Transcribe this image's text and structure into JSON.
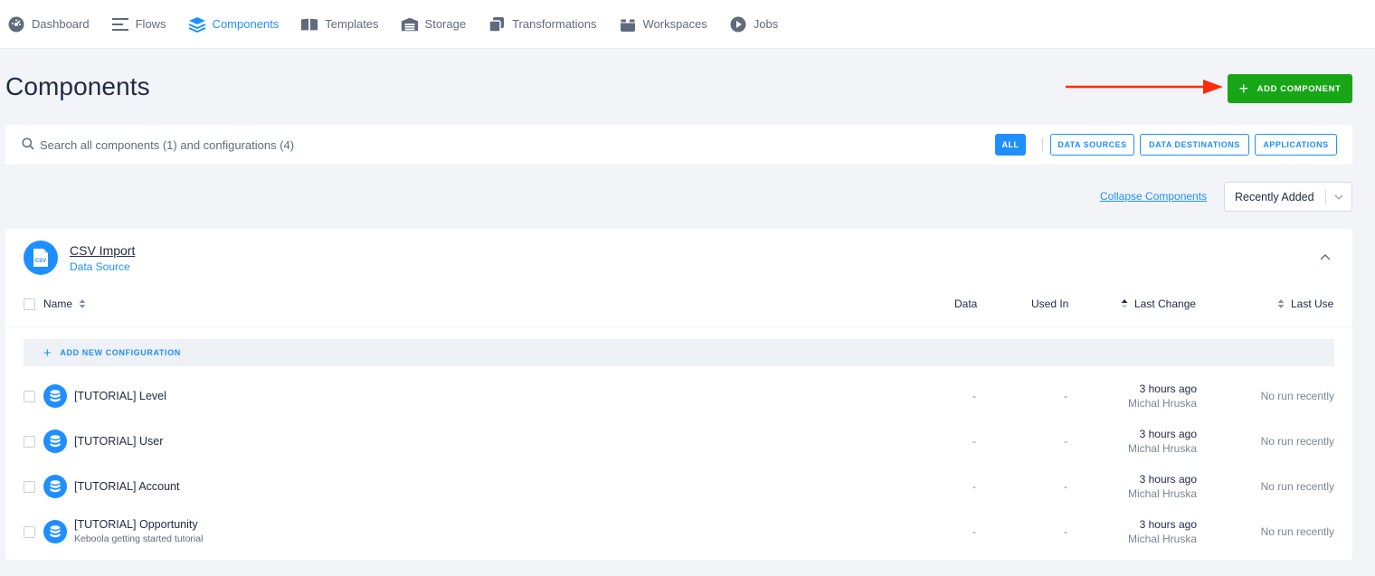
{
  "nav": {
    "items": [
      {
        "label": "Dashboard",
        "icon": "dashboard-icon",
        "active": false
      },
      {
        "label": "Flows",
        "icon": "flows-icon",
        "active": false
      },
      {
        "label": "Components",
        "icon": "layers-icon",
        "active": true
      },
      {
        "label": "Templates",
        "icon": "book-icon",
        "active": false
      },
      {
        "label": "Storage",
        "icon": "warehouse-icon",
        "active": false
      },
      {
        "label": "Transformations",
        "icon": "copy-icon",
        "active": false
      },
      {
        "label": "Workspaces",
        "icon": "box-icon",
        "active": false
      },
      {
        "label": "Jobs",
        "icon": "play-icon",
        "active": false
      }
    ]
  },
  "header": {
    "title": "Components",
    "add_label": "ADD COMPONENT"
  },
  "search": {
    "placeholder": "Search all components (1) and configurations (4)",
    "filters": {
      "all": "ALL",
      "sources": "DATA SOURCES",
      "destinations": "DATA DESTINATIONS",
      "applications": "APPLICATIONS"
    }
  },
  "toolbar": {
    "collapse_label": "Collapse Components",
    "sort_value": "Recently Added"
  },
  "component": {
    "name": "CSV Import",
    "type": "Data Source",
    "logo_text": "CSV",
    "columns": {
      "name": "Name",
      "data": "Data",
      "used_in": "Used In",
      "last_change": "Last Change",
      "last_use": "Last Use"
    },
    "add_config_label": "ADD NEW CONFIGURATION",
    "rows": [
      {
        "name": "[TUTORIAL] Level",
        "description": "",
        "data": "-",
        "used_in": "-",
        "changed": "3 hours ago",
        "changed_by": "Michal Hruska",
        "last_use": "No run recently"
      },
      {
        "name": "[TUTORIAL] User",
        "description": "",
        "data": "-",
        "used_in": "-",
        "changed": "3 hours ago",
        "changed_by": "Michal Hruska",
        "last_use": "No run recently"
      },
      {
        "name": "[TUTORIAL] Account",
        "description": "",
        "data": "-",
        "used_in": "-",
        "changed": "3 hours ago",
        "changed_by": "Michal Hruska",
        "last_use": "No run recently"
      },
      {
        "name": "[TUTORIAL] Opportunity",
        "description": "Keboola getting started tutorial",
        "data": "-",
        "used_in": "-",
        "changed": "3 hours ago",
        "changed_by": "Michal Hruska",
        "last_use": "No run recently"
      }
    ]
  },
  "colors": {
    "accent": "#1f8fff",
    "success": "#16a616",
    "annotation_arrow": "#ff2a0e"
  }
}
